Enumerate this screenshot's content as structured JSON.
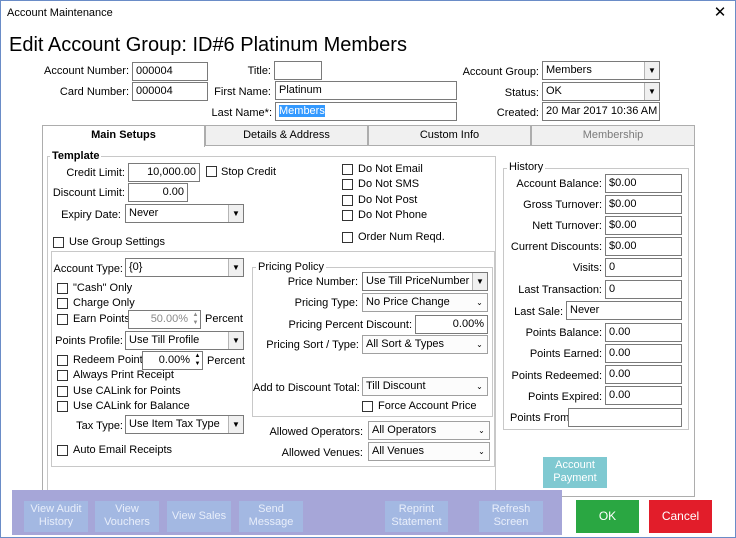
{
  "window": {
    "title": "Account Maintenance",
    "close_glyph": "✕"
  },
  "heading": "Edit Account Group: ID#6 Platinum Members",
  "header": {
    "account_number_label": "Account Number:",
    "account_number": "000004",
    "card_number_label": "Card Number:",
    "card_number": "000004",
    "title_label": "Title:",
    "title_value": "",
    "first_name_label": "First Name:",
    "first_name": "Platinum",
    "last_name_label": "Last Name*:",
    "last_name": "Members",
    "account_group_label": "Account Group:",
    "account_group": "Members",
    "status_label": "Status:",
    "status": "OK",
    "created_label": "Created:",
    "created": "20 Mar 2017 10:36 AM"
  },
  "tabs": [
    {
      "label": "Main Setups"
    },
    {
      "label": "Details & Address"
    },
    {
      "label": "Custom Info"
    },
    {
      "label": "Membership"
    }
  ],
  "template": {
    "title": "Template",
    "credit_limit_label": "Credit Limit:",
    "credit_limit": "10,000.00",
    "stop_credit_label": "Stop Credit",
    "discount_limit_label": "Discount Limit:",
    "discount_limit": "0.00",
    "expiry_date_label": "Expiry Date:",
    "expiry_date": "Never",
    "do_not_email": "Do Not Email",
    "do_not_sms": "Do Not SMS",
    "do_not_post": "Do Not Post",
    "do_not_phone": "Do Not Phone",
    "order_num_reqd": "Order Num Reqd.",
    "use_group_settings": "Use Group Settings",
    "account_type_label": "Account Type:",
    "account_type": "{0}",
    "cash_only": "\"Cash\" Only",
    "charge_only": "Charge Only",
    "earn_points": "Earn Points",
    "earn_points_value": "50.00%",
    "percent": "Percent",
    "points_profile_label": "Points Profile:",
    "points_profile": "Use Till Profile",
    "redeem_points": "Redeem Points",
    "redeem_points_value": "0.00%",
    "always_print_receipt": "Always Print Receipt",
    "use_calink_points": "Use CALink for Points",
    "use_calink_balance": "Use CALink for Balance",
    "tax_type_label": "Tax Type:",
    "tax_type": "Use Item Tax Type",
    "auto_email_receipts": "Auto Email Receipts"
  },
  "pricing": {
    "title": "Pricing Policy",
    "price_number_label": "Price Number:",
    "price_number": "Use Till PriceNumber",
    "pricing_type_label": "Pricing Type:",
    "pricing_type": "No Price Change",
    "percent_discount_label": "Pricing Percent Discount:",
    "percent_discount": "0.00%",
    "sort_type_label": "Pricing Sort / Type:",
    "sort_type": "All Sort & Types",
    "add_discount_total_label": "Add to Discount Total:",
    "add_discount_total": "Till Discount",
    "force_account_price": "Force Account Price"
  },
  "allowed": {
    "operators_label": "Allowed Operators:",
    "operators": "All Operators",
    "venues_label": "Allowed Venues:",
    "venues": "All Venues"
  },
  "history": {
    "title": "History",
    "account_balance_label": "Account Balance:",
    "account_balance": "$0.00",
    "gross_turnover_label": "Gross Turnover:",
    "gross_turnover": "$0.00",
    "nett_turnover_label": "Nett Turnover:",
    "nett_turnover": "$0.00",
    "current_discounts_label": "Current Discounts:",
    "current_discounts": "$0.00",
    "visits_label": "Visits:",
    "visits": "0",
    "last_transaction_label": "Last Transaction:",
    "last_transaction": "0",
    "last_sale_label": "Last Sale:",
    "last_sale": "Never",
    "points_balance_label": "Points Balance:",
    "points_balance": "0.00",
    "points_earned_label": "Points Earned:",
    "points_earned": "0.00",
    "points_redeemed_label": "Points Redeemed:",
    "points_redeemed": "0.00",
    "points_expired_label": "Points Expired:",
    "points_expired": "0.00",
    "points_from_label": "Points From:",
    "points_from": ""
  },
  "buttons": {
    "account_payment_1": "Account",
    "account_payment_2": "Payment",
    "view_audit_1": "View Audit",
    "view_audit_2": "History",
    "view_vouchers_1": "View",
    "view_vouchers_2": "Vouchers",
    "view_sales": "View Sales",
    "send_message_1": "Send",
    "send_message_2": "Message",
    "reprint_1": "Reprint",
    "reprint_2": "Statement",
    "refresh_1": "Refresh",
    "refresh_2": "Screen",
    "ok": "OK",
    "cancel": "Cancel"
  },
  "glyphs": {
    "dropdown": "▼",
    "spin_up": "▲",
    "spin_down": "▼",
    "chevron": "⌄"
  },
  "colors": {
    "ok": "#2aa742",
    "cancel": "#e21d2a",
    "payment": "#7fc9d1",
    "toolbar": "#a6a6d8",
    "toolbar_button": "#a3b8e2",
    "selection": "#3399ff"
  }
}
